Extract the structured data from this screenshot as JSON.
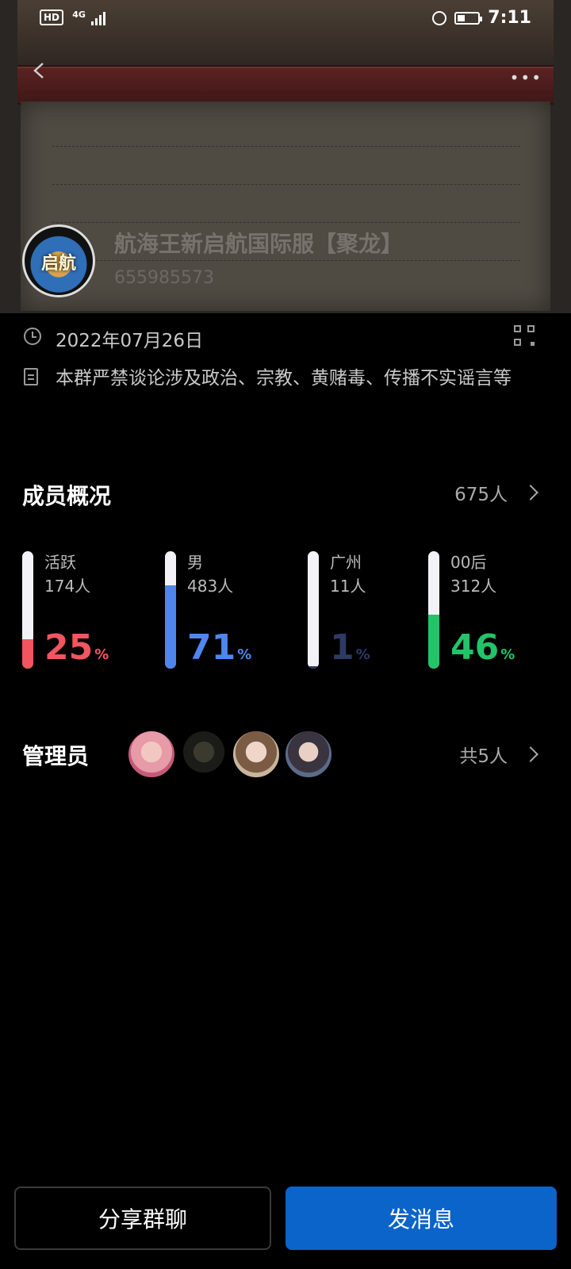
{
  "status_bar": {
    "hd": "HD",
    "network": "4G",
    "time": "7:11",
    "battery_level": 0.35
  },
  "header": {
    "group_name": "航海王新启航国际服【聚龙】",
    "group_id": "655985573",
    "avatar_text": "启航",
    "back_icon": "back-arrow-icon",
    "more_icon": "more-dots-icon"
  },
  "info": {
    "created_date": "2022年07月26日",
    "notice": "本群严禁谈论涉及政治、宗教、黄赌毒、传播不实谣言等",
    "qr_icon": "qr-code-icon"
  },
  "members": {
    "title": "成员概况",
    "total": "675人",
    "stats": [
      {
        "label": "活跃",
        "count": "174人",
        "percent": "25",
        "unit": "%",
        "value": 0.25,
        "color": "#f2555f"
      },
      {
        "label": "男",
        "count": "483人",
        "percent": "71",
        "unit": "%",
        "value": 0.71,
        "color": "#4f86ee"
      },
      {
        "label": "广州",
        "count": "11人",
        "percent": "1",
        "unit": "%",
        "value": 0.01,
        "color": "#2d3a63"
      },
      {
        "label": "00后",
        "count": "312人",
        "percent": "46",
        "unit": "%",
        "value": 0.46,
        "color": "#22c46a"
      }
    ]
  },
  "admins": {
    "title": "管理员",
    "total": "共5人"
  },
  "buttons": {
    "share": "分享群聊",
    "send": "发消息"
  }
}
